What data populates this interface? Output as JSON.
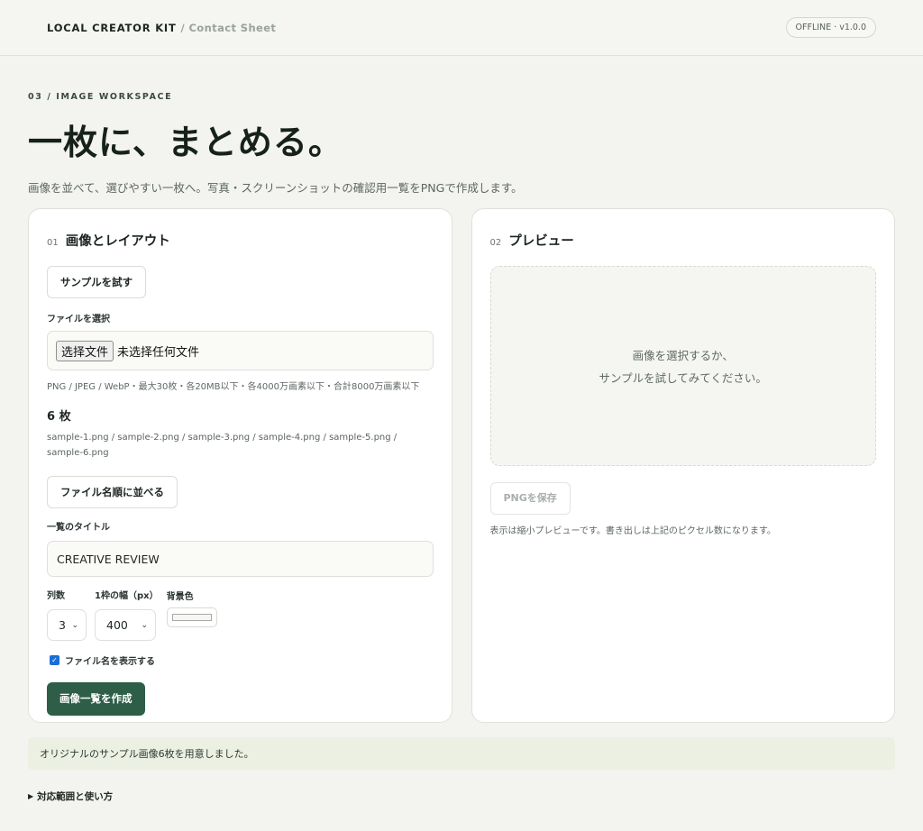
{
  "header": {
    "brand": "LOCAL CREATOR KIT",
    "brand_sub": "/ Contact Sheet",
    "version": "OFFLINE · v1.0.0"
  },
  "hero": {
    "eyebrow": "03 / IMAGE WORKSPACE",
    "title": "一枚に、まとめる。",
    "description": "画像を並べて、選びやすい一枚へ。写真・スクリーンショットの確認用一覧をPNGで作成します。"
  },
  "left_panel": {
    "num": "01",
    "title": "画像とレイアウト",
    "sample_button": "サンプルを試す",
    "file_label": "ファイルを選択",
    "file_button": "选择文件",
    "file_status": "未选择任何文件",
    "file_hint": "PNG / JPEG / WebP・最大30枚・各20MB以下・各4000万画素以下・合計8000万画素以下",
    "count": "6 枚",
    "filenames": "sample-1.png / sample-2.png / sample-3.png / sample-4.png / sample-5.png / sample-6.png",
    "sort_button": "ファイル名順に並べる",
    "title_label": "一覧のタイトル",
    "title_value": "CREATIVE REVIEW",
    "columns_label": "列数",
    "columns_value": "3",
    "width_label": "1枠の幅（px）",
    "width_value": "400",
    "bg_label": "背景色",
    "bg_color": "#f6f6f2",
    "show_names_label": "ファイル名を表示する",
    "show_names_checked": true,
    "create_button": "画像一覧を作成"
  },
  "right_panel": {
    "num": "02",
    "title": "プレビュー",
    "empty_line1": "画像を選択するか、",
    "empty_line2": "サンプルを試してみてください。",
    "save_button": "PNGを保存",
    "note": "表示は縮小プレビューです。書き出しは上記のピクセル数になります。"
  },
  "notice": "オリジナルのサンプル画像6枚を用意しました。",
  "details_summary": "対応範囲と使い方",
  "colors": {
    "accent": "#2e5e48",
    "notice_bg": "#ebf0e2",
    "checkbox": "#1a6fd6"
  }
}
